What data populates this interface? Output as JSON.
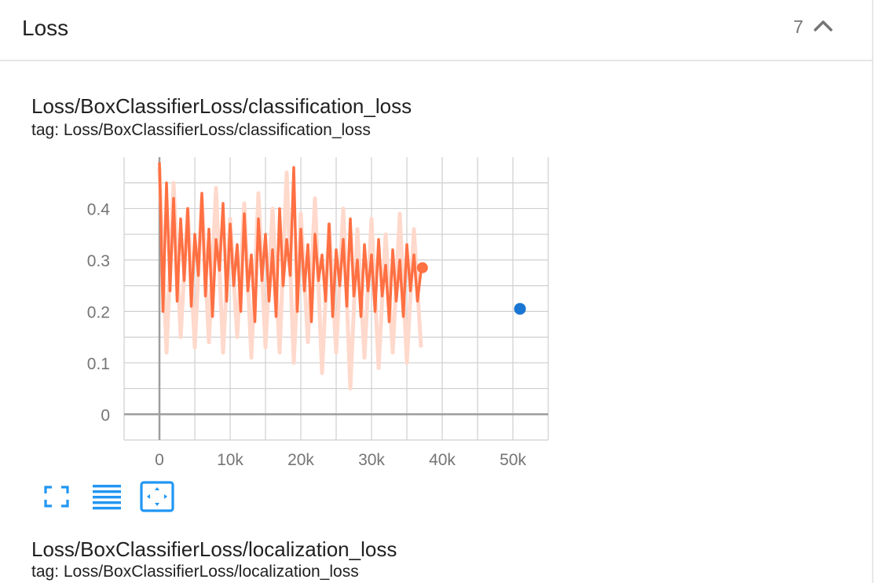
{
  "group": {
    "title": "Loss",
    "count": "7"
  },
  "cards": [
    {
      "title": "Loss/BoxClassifierLoss/classification_loss",
      "tag": "tag: Loss/BoxClassifierLoss/classification_loss"
    },
    {
      "title": "Loss/BoxClassifierLoss/localization_loss",
      "tag": "tag: Loss/BoxClassifierLoss/localization_loss"
    }
  ],
  "colors": {
    "smoothed_line": "#ff7043",
    "raw_line": "#ffd9cc",
    "point_blue": "#1976d2",
    "grid": "#cfcfcf",
    "axis": "#9e9e9e",
    "toolbar_icon": "#2196f3"
  },
  "toolbar": [
    {
      "icon": "fullscreen-icon"
    },
    {
      "icon": "toggle-y-log-icon"
    },
    {
      "icon": "fit-domain-icon"
    }
  ],
  "chart_data": {
    "type": "line",
    "xlim": [
      -5000,
      55000
    ],
    "ylim": [
      -0.05,
      0.5
    ],
    "x_ticks": [
      "0",
      "10k",
      "20k",
      "30k",
      "40k",
      "50k"
    ],
    "x_tick_values": [
      0,
      10000,
      20000,
      30000,
      40000,
      50000
    ],
    "y_ticks": [
      "0",
      "0.1",
      "0.2",
      "0.3",
      "0.4"
    ],
    "y_tick_values": [
      0,
      0.1,
      0.2,
      0.3,
      0.4
    ],
    "grid": true,
    "series": [
      {
        "role": "raw",
        "x": [
          0,
          1000,
          2000,
          3000,
          4000,
          5000,
          6000,
          7000,
          8000,
          9000,
          10000,
          11000,
          12000,
          13000,
          14000,
          15000,
          16000,
          17000,
          18000,
          19000,
          20000,
          21000,
          22000,
          23000,
          24000,
          25000,
          26000,
          27000,
          28000,
          29000,
          30000,
          31000,
          32000,
          33000,
          34000,
          35000,
          36000,
          37000
        ],
        "y": [
          0.48,
          0.12,
          0.45,
          0.15,
          0.4,
          0.13,
          0.42,
          0.14,
          0.44,
          0.12,
          0.38,
          0.15,
          0.41,
          0.11,
          0.43,
          0.13,
          0.4,
          0.12,
          0.47,
          0.1,
          0.39,
          0.14,
          0.42,
          0.08,
          0.37,
          0.12,
          0.4,
          0.05,
          0.36,
          0.11,
          0.38,
          0.09,
          0.35,
          0.12,
          0.39,
          0.1,
          0.36,
          0.13
        ]
      },
      {
        "role": "smoothed",
        "x": [
          0,
          500,
          1000,
          1500,
          2000,
          2500,
          3000,
          3500,
          4000,
          4500,
          5000,
          5500,
          6000,
          6500,
          7000,
          7500,
          8000,
          8500,
          9000,
          9500,
          10000,
          10500,
          11000,
          11500,
          12000,
          12500,
          13000,
          13500,
          14000,
          14500,
          15000,
          15500,
          16000,
          16500,
          17000,
          17500,
          18000,
          18500,
          19000,
          19500,
          20000,
          20500,
          21000,
          21500,
          22000,
          22500,
          23000,
          23500,
          24000,
          24500,
          25000,
          25500,
          26000,
          26500,
          27000,
          27500,
          28000,
          28500,
          29000,
          29500,
          30000,
          30500,
          31000,
          31500,
          32000,
          32500,
          33000,
          33500,
          34000,
          34500,
          35000,
          35500,
          36000,
          36500,
          37000
        ],
        "y": [
          0.49,
          0.2,
          0.45,
          0.24,
          0.42,
          0.22,
          0.38,
          0.26,
          0.4,
          0.21,
          0.35,
          0.27,
          0.43,
          0.23,
          0.36,
          0.19,
          0.34,
          0.28,
          0.41,
          0.22,
          0.37,
          0.25,
          0.33,
          0.2,
          0.39,
          0.24,
          0.31,
          0.18,
          0.38,
          0.26,
          0.35,
          0.22,
          0.32,
          0.19,
          0.4,
          0.25,
          0.34,
          0.27,
          0.48,
          0.2,
          0.36,
          0.24,
          0.33,
          0.18,
          0.35,
          0.26,
          0.31,
          0.22,
          0.37,
          0.19,
          0.32,
          0.25,
          0.34,
          0.21,
          0.38,
          0.23,
          0.3,
          0.19,
          0.33,
          0.24,
          0.31,
          0.2,
          0.34,
          0.23,
          0.29,
          0.18,
          0.32,
          0.22,
          0.3,
          0.19,
          0.33,
          0.24,
          0.31,
          0.22,
          0.28
        ]
      }
    ],
    "last_point": {
      "x": 37200,
      "y": 0.285
    },
    "extra_point": {
      "x": 51000,
      "y": 0.205
    }
  }
}
